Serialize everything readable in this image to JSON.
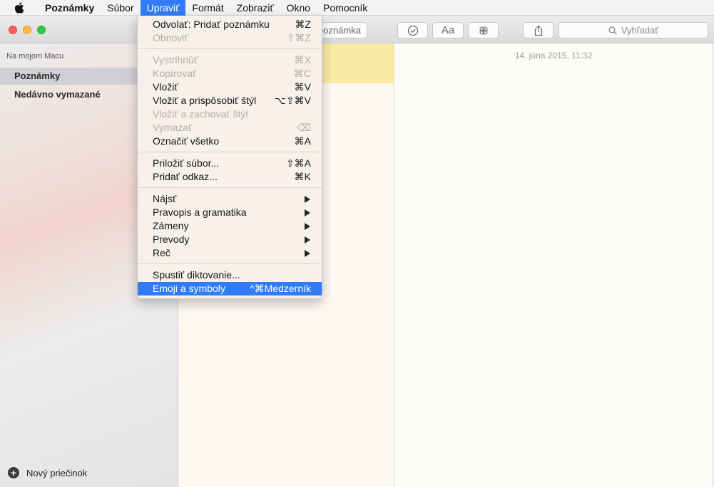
{
  "menubar": {
    "app_name": "Poznámky",
    "items": [
      "Súbor",
      "Upraviť",
      "Formát",
      "Zobraziť",
      "Okno",
      "Pomocník"
    ],
    "active_index": 1
  },
  "toolbar": {
    "new_note_label": "poznámka",
    "format_label": "Aa",
    "search_placeholder": "Vyhľadať"
  },
  "sidebar": {
    "section_header": "Na mojom Macu",
    "items": [
      {
        "label": "Poznámky",
        "selected": true
      },
      {
        "label": "Nedávno vymazané",
        "selected": false
      }
    ],
    "new_folder_label": "Nový priečinok"
  },
  "editor": {
    "date": "14. júna 2015, 11:32"
  },
  "edit_menu": {
    "groups": [
      [
        {
          "label": "Odvolať: Pridať poznámku",
          "shortcut": "⌘Z",
          "enabled": true
        },
        {
          "label": "Obnoviť",
          "shortcut": "⇧⌘Z",
          "enabled": false
        }
      ],
      [
        {
          "label": "Vystrihnúť",
          "shortcut": "⌘X",
          "enabled": false
        },
        {
          "label": "Kopírovať",
          "shortcut": "⌘C",
          "enabled": false
        },
        {
          "label": "Vložiť",
          "shortcut": "⌘V",
          "enabled": true
        },
        {
          "label": "Vložiť a prispôsobiť štýl",
          "shortcut": "⌥⇧⌘V",
          "enabled": true
        },
        {
          "label": "Vložiť a zachovať štýl",
          "shortcut": "",
          "enabled": false
        },
        {
          "label": "Vymazať",
          "shortcut": "⌫",
          "enabled": false
        },
        {
          "label": "Označiť všetko",
          "shortcut": "⌘A",
          "enabled": true
        }
      ],
      [
        {
          "label": "Priložiť súbor...",
          "shortcut": "⇧⌘A",
          "enabled": true
        },
        {
          "label": "Pridať odkaz...",
          "shortcut": "⌘K",
          "enabled": true
        }
      ],
      [
        {
          "label": "Nájsť",
          "submenu": true,
          "enabled": true
        },
        {
          "label": "Pravopis a gramatika",
          "submenu": true,
          "enabled": true
        },
        {
          "label": "Zámeny",
          "submenu": true,
          "enabled": true
        },
        {
          "label": "Prevody",
          "submenu": true,
          "enabled": true
        },
        {
          "label": "Reč",
          "submenu": true,
          "enabled": true
        }
      ],
      [
        {
          "label": "Spustiť diktovanie...",
          "shortcut": "",
          "enabled": true
        },
        {
          "label": "Emoji a symboly",
          "shortcut": "^⌘Medzerník",
          "enabled": true,
          "highlighted": true
        }
      ]
    ]
  },
  "colors": {
    "accent": "#2f7cf6",
    "selected_note": "#fbe9a6",
    "traffic_red": "#fc605c",
    "traffic_yellow": "#fdbc40",
    "traffic_green": "#34c84a"
  }
}
